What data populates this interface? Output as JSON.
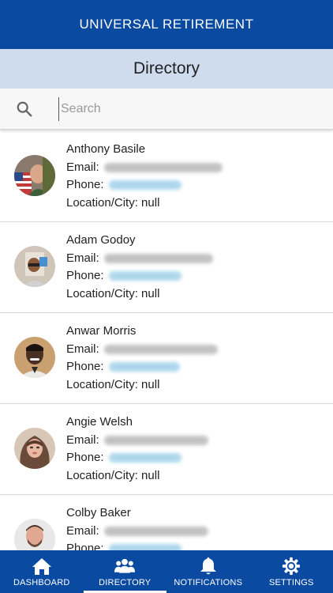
{
  "app": {
    "title": "UNIVERSAL RETIREMENT"
  },
  "page": {
    "title": "Directory"
  },
  "search": {
    "placeholder": "Search",
    "value": ""
  },
  "labels": {
    "email": "Email:",
    "phone": "Phone:",
    "location": "Location/City: null"
  },
  "contacts": [
    {
      "name": "Anthony Basile"
    },
    {
      "name": "Adam Godoy"
    },
    {
      "name": "Anwar Morris"
    },
    {
      "name": "Angie Welsh"
    },
    {
      "name": "Colby Baker"
    }
  ],
  "nav": [
    {
      "label": "DASHBOARD",
      "icon": "home-icon"
    },
    {
      "label": "DIRECTORY",
      "icon": "people-icon",
      "active": true
    },
    {
      "label": "NOTIFICATIONS",
      "icon": "bell-icon"
    },
    {
      "label": "SETTINGS",
      "icon": "gear-icon"
    }
  ],
  "colors": {
    "primary": "#0a4aa0",
    "subheader": "#cfdced"
  }
}
